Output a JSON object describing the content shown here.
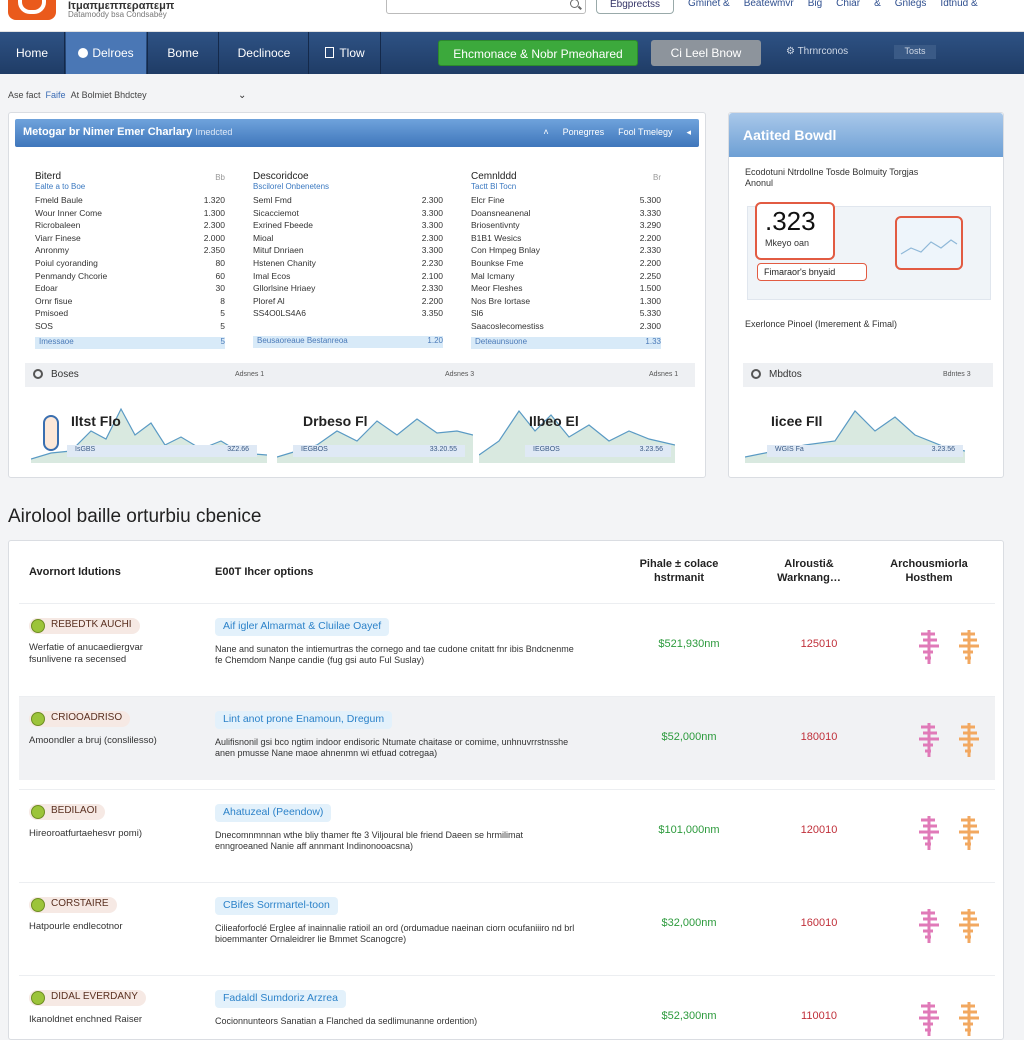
{
  "topbar": {
    "brand": "Ιτμαπμεππεραπεμπ",
    "brand_sub": "Datamoody bsa Condsabey",
    "search_placeholder": "",
    "button": "Ebgprectss",
    "links": [
      "Gminet &",
      "Beatewmvr",
      "Big",
      "Chiar",
      "&",
      "Gnlegs",
      "Idtnud &"
    ]
  },
  "nav": {
    "items": [
      "Home",
      "Delroes",
      "Bome",
      "Declinoce",
      "Tlow"
    ],
    "green_button": "Ehcmonace & Nobr Pmeohared",
    "gray_button": "Ci Leel Bnow",
    "tool": "Thrnrconos",
    "tag": "Tosts"
  },
  "breadcrumb": {
    "home": "Ase fact",
    "link": "Faife",
    "rest": "At Bolmiet Bhdctey"
  },
  "metrics_panel": {
    "title": "Metogar br Nimer Emer Charlary",
    "title_small": "Imedcted",
    "head_links": [
      "Ponegrres",
      "Fool Tmelegy"
    ],
    "columns": [
      {
        "title": "Biterd",
        "sub": "Ealte a to Boe",
        "corner": "Bb",
        "rows": [
          {
            "label": "Fmeld Baule",
            "value": "1.320"
          },
          {
            "label": "Wour Inner Come",
            "value": "1.300"
          },
          {
            "label": "Ricrobaleen",
            "value": "2.300"
          },
          {
            "label": "Viarr Finese",
            "value": "2.000"
          },
          {
            "label": "Anronmy",
            "value": "2.350"
          },
          {
            "label": "Poiul cyoranding",
            "value": "80"
          },
          {
            "label": "Penmandy Chcorie",
            "value": "60"
          },
          {
            "label": "Edoar",
            "value": "30"
          },
          {
            "label": "Ornr fisue",
            "value": "8"
          },
          {
            "label": "Pmisoed",
            "value": "5"
          },
          {
            "label": "SOS",
            "value": "5"
          }
        ],
        "foot": "Imessaoe",
        "foot_value": "5"
      },
      {
        "title": "Descoridcoe",
        "sub": "Bscilorel Onbenetens",
        "corner": "",
        "rows": [
          {
            "label": "Seml Fmd",
            "value": "2.300"
          },
          {
            "label": "Sicacciemot",
            "value": "3.300"
          },
          {
            "label": "Exrined Fbeede",
            "value": "3.300"
          },
          {
            "label": "Mioal",
            "value": "2.300"
          },
          {
            "label": "Mituf Dnriaen",
            "value": "3.300"
          },
          {
            "label": "Hstenen Chanity",
            "value": "2.230"
          },
          {
            "label": "Imal Ecos",
            "value": "2.100"
          },
          {
            "label": "Gllorlsine Hriaey",
            "value": "2.330"
          },
          {
            "label": "Ploref Al",
            "value": "2.200"
          },
          {
            "label": "SS4O0LS4A6",
            "value": "3.350"
          }
        ],
        "foot": "Beusaoreaue Bestanreoa",
        "foot_value": "1.20"
      },
      {
        "title": "Cemnlddd",
        "sub": "Tactt Bl Tocn",
        "corner": "Br",
        "rows": [
          {
            "label": "Elcr Fine",
            "value": "5.300"
          },
          {
            "label": "Doansneanenal",
            "value": "3.330"
          },
          {
            "label": "Briosentivnty",
            "value": "3.290"
          },
          {
            "label": "B1B1 Wesics",
            "value": "2.200"
          },
          {
            "label": "Con Hmpeg Bnlay",
            "value": "2.330"
          },
          {
            "label": "Bounkse Fme",
            "value": "2.200"
          },
          {
            "label": "Mal Icmany",
            "value": "2.250"
          },
          {
            "label": "Meor Fleshes",
            "value": "1.500"
          },
          {
            "label": "Nos Bre Iortase",
            "value": "1.300"
          },
          {
            "label": "Sl6",
            "value": "5.330"
          },
          {
            "label": "Saacoslecomestiss",
            "value": "2.300"
          }
        ],
        "foot": "Deteaunsuone",
        "foot_value": "1.33"
      }
    ],
    "charts_bar": {
      "label": "Boses",
      "axis": [
        "Adsnes 1",
        "Adsnes 3",
        "Adsnes 1"
      ]
    },
    "mini_charts": [
      {
        "caption": "Iltst Flo",
        "legend": "IsGBS",
        "legend_value": "3Z2.66"
      },
      {
        "caption": "Drbeso Fl",
        "legend": "IEGBOS",
        "legend_value": "33.20.55"
      },
      {
        "caption": "Ilbeo El",
        "legend": "IEGBOS",
        "legend_value": "3.23.56"
      }
    ]
  },
  "avg_panel": {
    "title": "Aatited Bowdl",
    "desc_line1": "Ecodotuni Ntrdollne Tosde Bolmuity Torgjas",
    "desc_line2": "Anonul",
    "big_value": ".323",
    "big_label": "Mkeyo oan",
    "pill_label": "Fimaraor's bnyaid",
    "footer": "Exerlonce Pinoel (Imerement & Fimal)",
    "charts_bar": {
      "label": "Mbdtos",
      "axis": "Bdntes 3"
    },
    "mini_chart": {
      "caption": "Iicee FIl",
      "legend": "WGIS Fa",
      "legend_value": "3.23.56"
    }
  },
  "section": {
    "title": "Airolool baille orturbiu cbenice"
  },
  "table": {
    "headers": {
      "c1": "Avornort Idutions",
      "c2": "E00T Ihcer options",
      "c3": "Pihale ± colace hstrmanit",
      "c4": "Alrousti& Warknang…",
      "c5": "Archousmiorla Hosthem"
    },
    "rows": [
      {
        "tag": "REBEDTK AUCHI",
        "desc": "Werfatie of anucaediergvar fsunlivene ra secensed",
        "option": "Aif igler Almarmat & Cluilae Oayef",
        "opt_desc": "Nane and sunaton the intiemurtras the cornego and tae cudone cnitatt fnr ibis Bndcnenme fe Chemdom Nanpe candie (fug gsi auto Ful Suslay)",
        "price": "$521,930nm",
        "count": "125010"
      },
      {
        "tag": "CRIOOADRISO",
        "desc": "Amoondler a bruj (conslilesso)",
        "option": "Lint anot prone Enamoun, Dregum",
        "opt_desc": "Aulifisnonil gsi bco ngtim indoor endisoric Ntumate chaitase or comime, unhnuvrrstnsshe anen pmusse Nane maoe ahnenmn wi etfuad cotregaa)",
        "price": "$52,000nm",
        "count": "180010"
      },
      {
        "tag": "BEDILAOI",
        "desc": "Hireoroatfurtaehesvr pomi)",
        "option": "Ahatuzeal (Peendow)",
        "opt_desc": "Dnecomnmnnan wthe bliy thamer fte 3 Viljoural ble friend Daeen se hrmilimat enngroeaned Nanie aff annmant Indinonooacsna)",
        "price": "$101,000nm",
        "count": "120010"
      },
      {
        "tag": "CORSTAIRE",
        "desc": "Hatpourle endlecotnor",
        "option": "CBifes Sorrmartel-toon",
        "opt_desc": "Cilieaforfoclé Erglee af inainnalie ratioil an ord (ordumadue naeinan ciorn ocufaniiiro nd brl bioemmanter Ornaleidrer lie Bmmet Scanogcre)",
        "price": "$32,000nm",
        "count": "160010"
      },
      {
        "tag": "DIDAL EVERDANY",
        "desc": "Ikanoldnet enchned Raiser",
        "option": "Fadaldl Sumdoriz Arzrea",
        "opt_desc": "Cocionnunteors Sanatian a Flanched da sedlimunanne ordention)",
        "price": "$52,300nm",
        "count": "110010"
      }
    ]
  }
}
